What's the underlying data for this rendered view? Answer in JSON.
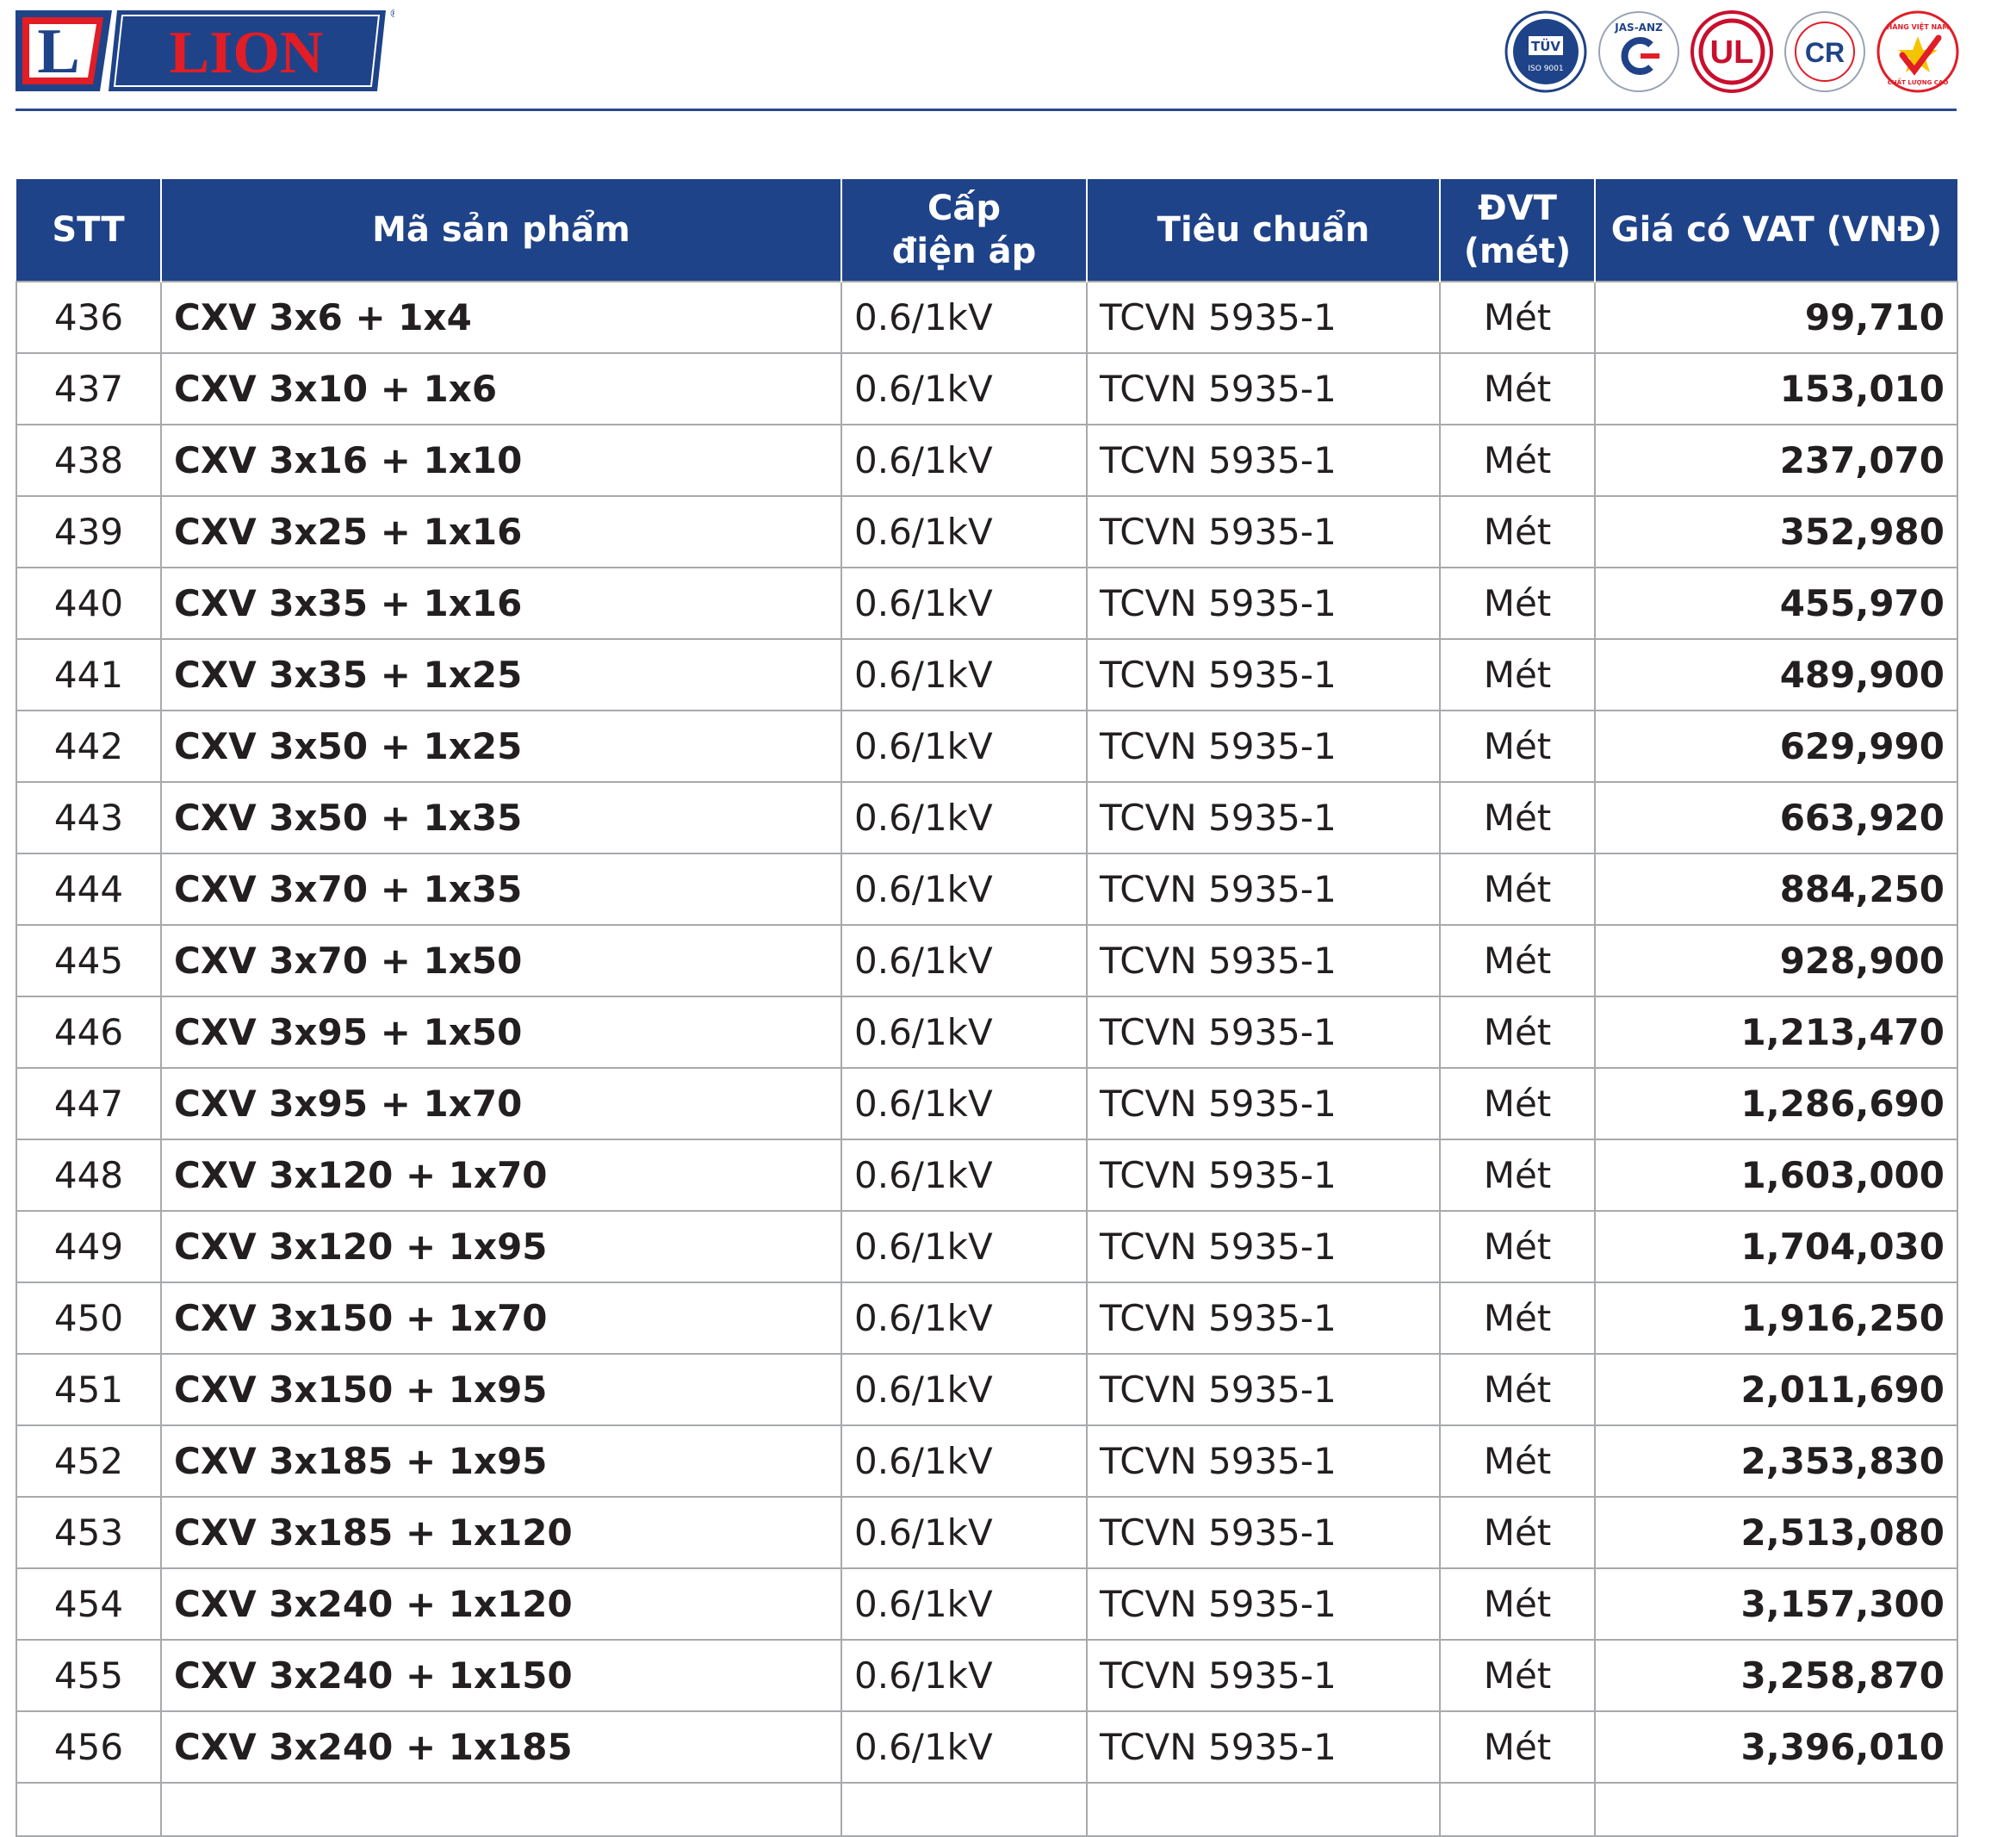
{
  "brand": {
    "name": "LION",
    "mark": "L",
    "registered": "®"
  },
  "certifications": [
    {
      "icon": "tuv-iso-9001-icon",
      "lines": [
        "TÜV",
        "ISO 9001"
      ]
    },
    {
      "icon": "jas-anz-icon",
      "lines": [
        "JAS-ANZ"
      ]
    },
    {
      "icon": "ul-icon",
      "lines": [
        "UL"
      ]
    },
    {
      "icon": "quatest-cr-icon",
      "lines": [
        "CR"
      ]
    },
    {
      "icon": "hang-viet-nam-chat-luong-cao-icon",
      "lines": [
        "HÀNG VIỆT NAM",
        "CHẤT LƯỢNG CAO"
      ]
    }
  ],
  "colors": {
    "brand_blue": "#1f4388",
    "brand_red": "#e11d26",
    "grid": "#a7a9ac"
  },
  "table": {
    "headers": {
      "stt": "STT",
      "code": "Mã sản phẩm",
      "voltage_1": "Cấp",
      "voltage_2": "điện áp",
      "standard": "Tiêu chuẩn",
      "unit_1": "ĐVT",
      "unit_2": "(mét)",
      "price": "Giá có VAT (VNĐ)"
    },
    "rows": [
      {
        "stt": "436",
        "code": "CXV 3x6 + 1x4",
        "voltage": "0.6/1kV",
        "standard": "TCVN 5935-1",
        "unit": "Mét",
        "price": "99,710"
      },
      {
        "stt": "437",
        "code": "CXV 3x10 + 1x6",
        "voltage": "0.6/1kV",
        "standard": "TCVN 5935-1",
        "unit": "Mét",
        "price": "153,010"
      },
      {
        "stt": "438",
        "code": "CXV 3x16 + 1x10",
        "voltage": "0.6/1kV",
        "standard": "TCVN 5935-1",
        "unit": "Mét",
        "price": "237,070"
      },
      {
        "stt": "439",
        "code": "CXV 3x25 + 1x16",
        "voltage": "0.6/1kV",
        "standard": "TCVN 5935-1",
        "unit": "Mét",
        "price": "352,980"
      },
      {
        "stt": "440",
        "code": "CXV 3x35 + 1x16",
        "voltage": "0.6/1kV",
        "standard": "TCVN 5935-1",
        "unit": "Mét",
        "price": "455,970"
      },
      {
        "stt": "441",
        "code": "CXV 3x35 + 1x25",
        "voltage": "0.6/1kV",
        "standard": "TCVN 5935-1",
        "unit": "Mét",
        "price": "489,900"
      },
      {
        "stt": "442",
        "code": "CXV 3x50 + 1x25",
        "voltage": "0.6/1kV",
        "standard": "TCVN 5935-1",
        "unit": "Mét",
        "price": "629,990"
      },
      {
        "stt": "443",
        "code": "CXV 3x50 + 1x35",
        "voltage": "0.6/1kV",
        "standard": "TCVN 5935-1",
        "unit": "Mét",
        "price": "663,920"
      },
      {
        "stt": "444",
        "code": "CXV 3x70 + 1x35",
        "voltage": "0.6/1kV",
        "standard": "TCVN 5935-1",
        "unit": "Mét",
        "price": "884,250"
      },
      {
        "stt": "445",
        "code": "CXV 3x70 + 1x50",
        "voltage": "0.6/1kV",
        "standard": "TCVN 5935-1",
        "unit": "Mét",
        "price": "928,900"
      },
      {
        "stt": "446",
        "code": "CXV 3x95 + 1x50",
        "voltage": "0.6/1kV",
        "standard": "TCVN 5935-1",
        "unit": "Mét",
        "price": "1,213,470"
      },
      {
        "stt": "447",
        "code": "CXV 3x95 + 1x70",
        "voltage": "0.6/1kV",
        "standard": "TCVN 5935-1",
        "unit": "Mét",
        "price": "1,286,690"
      },
      {
        "stt": "448",
        "code": "CXV 3x120 + 1x70",
        "voltage": "0.6/1kV",
        "standard": "TCVN 5935-1",
        "unit": "Mét",
        "price": "1,603,000"
      },
      {
        "stt": "449",
        "code": "CXV 3x120 + 1x95",
        "voltage": "0.6/1kV",
        "standard": "TCVN 5935-1",
        "unit": "Mét",
        "price": "1,704,030"
      },
      {
        "stt": "450",
        "code": "CXV 3x150 + 1x70",
        "voltage": "0.6/1kV",
        "standard": "TCVN 5935-1",
        "unit": "Mét",
        "price": "1,916,250"
      },
      {
        "stt": "451",
        "code": "CXV 3x150 + 1x95",
        "voltage": "0.6/1kV",
        "standard": "TCVN 5935-1",
        "unit": "Mét",
        "price": "2,011,690"
      },
      {
        "stt": "452",
        "code": "CXV 3x185 + 1x95",
        "voltage": "0.6/1kV",
        "standard": "TCVN 5935-1",
        "unit": "Mét",
        "price": "2,353,830"
      },
      {
        "stt": "453",
        "code": "CXV 3x185 + 1x120",
        "voltage": "0.6/1kV",
        "standard": "TCVN 5935-1",
        "unit": "Mét",
        "price": "2,513,080"
      },
      {
        "stt": "454",
        "code": "CXV 3x240 + 1x120",
        "voltage": "0.6/1kV",
        "standard": "TCVN 5935-1",
        "unit": "Mét",
        "price": "3,157,300"
      },
      {
        "stt": "455",
        "code": "CXV 3x240 + 1x150",
        "voltage": "0.6/1kV",
        "standard": "TCVN 5935-1",
        "unit": "Mét",
        "price": "3,258,870"
      },
      {
        "stt": "456",
        "code": "CXV 3x240 + 1x185",
        "voltage": "0.6/1kV",
        "standard": "TCVN 5935-1",
        "unit": "Mét",
        "price": "3,396,010"
      }
    ]
  }
}
